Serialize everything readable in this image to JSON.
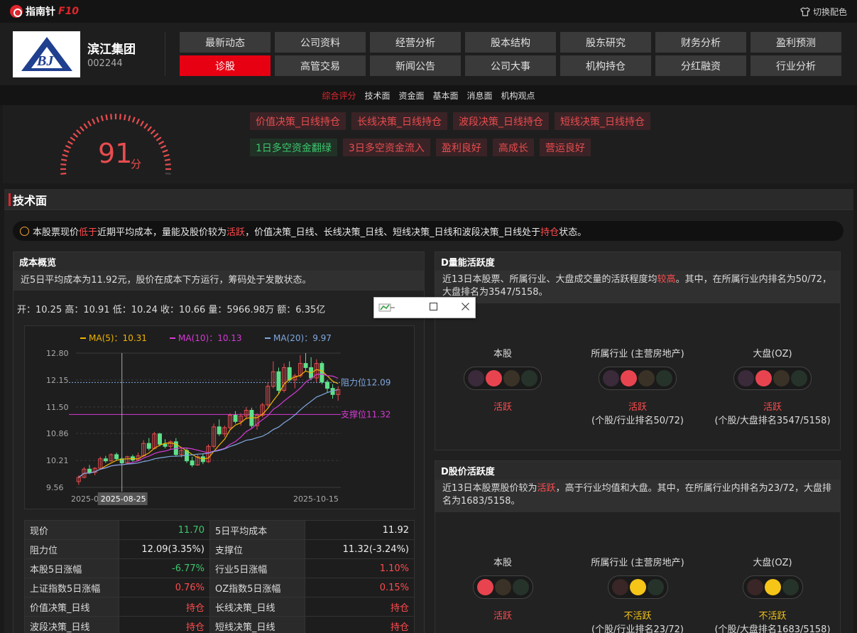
{
  "topbar": {
    "brand_text": "指南针",
    "brand_f10": "F10",
    "theme_switch": "切换配色"
  },
  "company": {
    "name": "滨江集团",
    "code": "002244",
    "logo_text": "BJ"
  },
  "nav": [
    {
      "label": "最新动态",
      "active": false
    },
    {
      "label": "公司资料",
      "active": false
    },
    {
      "label": "经营分析",
      "active": false
    },
    {
      "label": "股本结构",
      "active": false
    },
    {
      "label": "股东研究",
      "active": false
    },
    {
      "label": "财务分析",
      "active": false
    },
    {
      "label": "盈利预测",
      "active": false
    },
    {
      "label": "诊股",
      "active": true
    },
    {
      "label": "高管交易",
      "active": false
    },
    {
      "label": "新闻公告",
      "active": false
    },
    {
      "label": "公司大事",
      "active": false
    },
    {
      "label": "机构持仓",
      "active": false
    },
    {
      "label": "分红融资",
      "active": false
    },
    {
      "label": "行业分析",
      "active": false
    }
  ],
  "subnav": [
    "综合评分",
    "技术面",
    "资金面",
    "基本面",
    "消息面",
    "机构观点"
  ],
  "score": {
    "value": "91",
    "unit": "分",
    "fraction": 0.91
  },
  "tags_row1": [
    "价值决策_日线持仓",
    "长线决策_日线持仓",
    "波段决策_日线持仓",
    "短线决策_日线持仓"
  ],
  "tags_row2": [
    {
      "text": "1日多空资金翻绿",
      "color": "green"
    },
    {
      "text": "3日多空资金流入",
      "color": "red"
    },
    {
      "text": "盈利良好",
      "color": "red"
    },
    {
      "text": "高成长",
      "color": "red"
    },
    {
      "text": "营运良好",
      "color": "red"
    }
  ],
  "section_title": "技术面",
  "summary": {
    "p1": "本股票现价",
    "h1": "低于",
    "p2": "近期平均成本，量能及股价较为",
    "h2": "活跃",
    "p3": "，价值决策_日线、长线决策_日线、短线决策_日线和波段决策_日线处于",
    "h3": "持仓",
    "p4": "状态。"
  },
  "cost": {
    "title": "成本概览",
    "desc": "近5日平均成本为11.92元，股价在成本下方运行，筹码处于发散状态。",
    "ohlc": "开：10.25 高：10.91 低：10.24 收：10.66 量：5966.98万 额：6.35亿"
  },
  "chart_data": {
    "type": "candlestick",
    "ma_legend": [
      {
        "label": "MA(5)：10.31",
        "color": "#f0b400"
      },
      {
        "label": "MA(10)：10.13",
        "color": "#d63ad6"
      },
      {
        "label": "MA(20)：9.97",
        "color": "#7fa8e0"
      }
    ],
    "y_ticks": [
      "12.80",
      "12.15",
      "11.50",
      "10.86",
      "10.21",
      "9.56"
    ],
    "ylim": [
      9.56,
      12.8
    ],
    "x_labels": [
      "2025-08-",
      "2025-08-25",
      "2025-10-15"
    ],
    "resistance": {
      "label": "阻力位12.09",
      "value": 12.09,
      "color": "#7fa8e0"
    },
    "support": {
      "label": "支撑位11.32",
      "value": 11.32,
      "color": "#d63ad6"
    },
    "candles": [
      [
        9.7,
        9.85,
        9.62,
        9.8
      ],
      [
        9.8,
        10.05,
        9.78,
        10.0
      ],
      [
        10.0,
        10.1,
        9.88,
        9.92
      ],
      [
        9.92,
        10.05,
        9.85,
        10.02
      ],
      [
        10.02,
        10.3,
        10.0,
        10.25
      ],
      [
        10.25,
        10.32,
        10.15,
        10.2
      ],
      [
        10.2,
        10.38,
        10.18,
        10.35
      ],
      [
        10.35,
        10.4,
        10.2,
        10.25
      ],
      [
        10.25,
        10.3,
        10.1,
        10.15
      ],
      [
        10.15,
        10.32,
        10.12,
        10.3
      ],
      [
        10.3,
        10.35,
        10.18,
        10.22
      ],
      [
        10.22,
        10.4,
        10.2,
        10.32
      ],
      [
        10.32,
        10.7,
        10.3,
        10.62
      ],
      [
        10.62,
        10.75,
        10.45,
        10.5
      ],
      [
        10.5,
        10.9,
        10.48,
        10.85
      ],
      [
        10.85,
        10.88,
        10.55,
        10.6
      ],
      [
        10.6,
        10.72,
        10.5,
        10.55
      ],
      [
        10.55,
        10.7,
        10.48,
        10.66
      ],
      [
        10.66,
        10.75,
        10.3,
        10.35
      ],
      [
        10.35,
        10.5,
        10.28,
        10.45
      ],
      [
        10.45,
        10.5,
        10.15,
        10.2
      ],
      [
        10.2,
        10.3,
        10.05,
        10.1
      ],
      [
        10.1,
        10.35,
        10.08,
        10.3
      ],
      [
        10.3,
        10.38,
        10.12,
        10.18
      ],
      [
        10.18,
        10.6,
        10.15,
        10.55
      ],
      [
        10.55,
        11.1,
        10.5,
        11.02
      ],
      [
        11.02,
        11.2,
        10.8,
        10.85
      ],
      [
        10.85,
        11.05,
        10.78,
        11.0
      ],
      [
        11.0,
        11.35,
        10.95,
        11.3
      ],
      [
        11.3,
        11.4,
        11.1,
        11.15
      ],
      [
        11.15,
        11.35,
        11.05,
        11.28
      ],
      [
        11.28,
        11.5,
        11.2,
        11.42
      ],
      [
        11.42,
        11.48,
        11.0,
        11.05
      ],
      [
        11.05,
        11.35,
        10.95,
        11.3
      ],
      [
        11.3,
        11.6,
        11.25,
        11.55
      ],
      [
        11.55,
        12.1,
        11.5,
        12.0
      ],
      [
        12.0,
        12.6,
        11.95,
        12.35
      ],
      [
        12.35,
        12.45,
        11.8,
        11.9
      ],
      [
        11.9,
        12.55,
        11.85,
        12.45
      ],
      [
        12.45,
        12.6,
        12.1,
        12.15
      ],
      [
        12.15,
        12.3,
        11.95,
        12.25
      ],
      [
        12.25,
        12.75,
        12.2,
        12.55
      ],
      [
        12.55,
        12.8,
        12.35,
        12.45
      ],
      [
        12.45,
        12.7,
        12.15,
        12.2
      ],
      [
        12.2,
        12.65,
        12.1,
        12.55
      ],
      [
        12.55,
        12.6,
        12.05,
        12.1
      ],
      [
        12.1,
        12.15,
        11.85,
        11.95
      ],
      [
        11.95,
        12.05,
        11.7,
        11.8
      ],
      [
        11.8,
        12.0,
        11.65,
        11.92
      ]
    ]
  },
  "stats": [
    [
      {
        "k": "现价",
        "v": "11.70",
        "c": "green"
      },
      {
        "k": "5日平均成本",
        "v": "11.92",
        "c": "white"
      }
    ],
    [
      {
        "k": "阻力位",
        "v": "12.09(3.35%)",
        "c": "white"
      },
      {
        "k": "支撑位",
        "v": "11.32(-3.24%)",
        "c": "white"
      }
    ],
    [
      {
        "k": "本股5日涨幅",
        "v": "-6.77%",
        "c": "green"
      },
      {
        "k": "行业5日涨幅",
        "v": "1.10%",
        "c": "red"
      }
    ],
    [
      {
        "k": "上证指数5日涨幅",
        "v": "0.76%",
        "c": "red"
      },
      {
        "k": "OZ指数5日涨幅",
        "v": "0.15%",
        "c": "red"
      }
    ],
    [
      {
        "k": "价值决策_日线",
        "v": "持仓",
        "c": "red"
      },
      {
        "k": "长线决策_日线",
        "v": "持仓",
        "c": "red"
      }
    ],
    [
      {
        "k": "波段决策_日线",
        "v": "持仓",
        "c": "red"
      },
      {
        "k": "短线决策_日线",
        "v": "持仓",
        "c": "red"
      }
    ]
  ],
  "volume": {
    "title": "D量能活跃度",
    "desc_a": "近13日本股票、所属行业、大盘成交量的活跃程度均",
    "desc_h": "较高",
    "desc_b": "。其中，在所属行业内排名为50/72，大盘排名为3547/5158。",
    "lights": [
      {
        "label": "本股",
        "state": "活跃",
        "rank": "",
        "lamps": [
          "#3a2a3a",
          "#e84450",
          "#3a3226",
          "#26332a"
        ],
        "state_color": "#ff4b4e"
      },
      {
        "label": "所属行业 (主营房地产)",
        "state": "活跃",
        "rank": "(个股/行业排名50/72)",
        "lamps": [
          "#3a2a3a",
          "#e84450",
          "#3a3226",
          "#26332a"
        ],
        "state_color": "#ff4b4e"
      },
      {
        "label": "大盘(OZ)",
        "state": "活跃",
        "rank": "(个股/大盘排名3547/5158)",
        "lamps": [
          "#3a2a3a",
          "#e84450",
          "#3a3226",
          "#26332a"
        ],
        "state_color": "#ff4b4e"
      }
    ]
  },
  "price": {
    "title": "D股价活跃度",
    "desc_a": "近13日本股票股价较为",
    "desc_h": "活跃",
    "desc_b": "，高于行业均值和大盘。其中，在所属行业内排名为23/72，大盘排名为1683/5158。",
    "lights": [
      {
        "label": "本股",
        "state": "活跃",
        "rank": "",
        "lamps": [
          "#e84450",
          "#3a3226",
          "#26332a"
        ],
        "state_color": "#ff4b4e"
      },
      {
        "label": "所属行业 (主营房地产)",
        "state": "不活跃",
        "rank": "(个股/行业排名23/72)",
        "lamps": [
          "#3a2626",
          "#f5c518",
          "#26332a"
        ],
        "state_color": "#f5c518"
      },
      {
        "label": "大盘(OZ)",
        "state": "不活跃",
        "rank": "(个股/大盘排名1683/5158)",
        "lamps": [
          "#3a2626",
          "#f5c518",
          "#26332a"
        ],
        "state_color": "#f5c518"
      }
    ]
  }
}
